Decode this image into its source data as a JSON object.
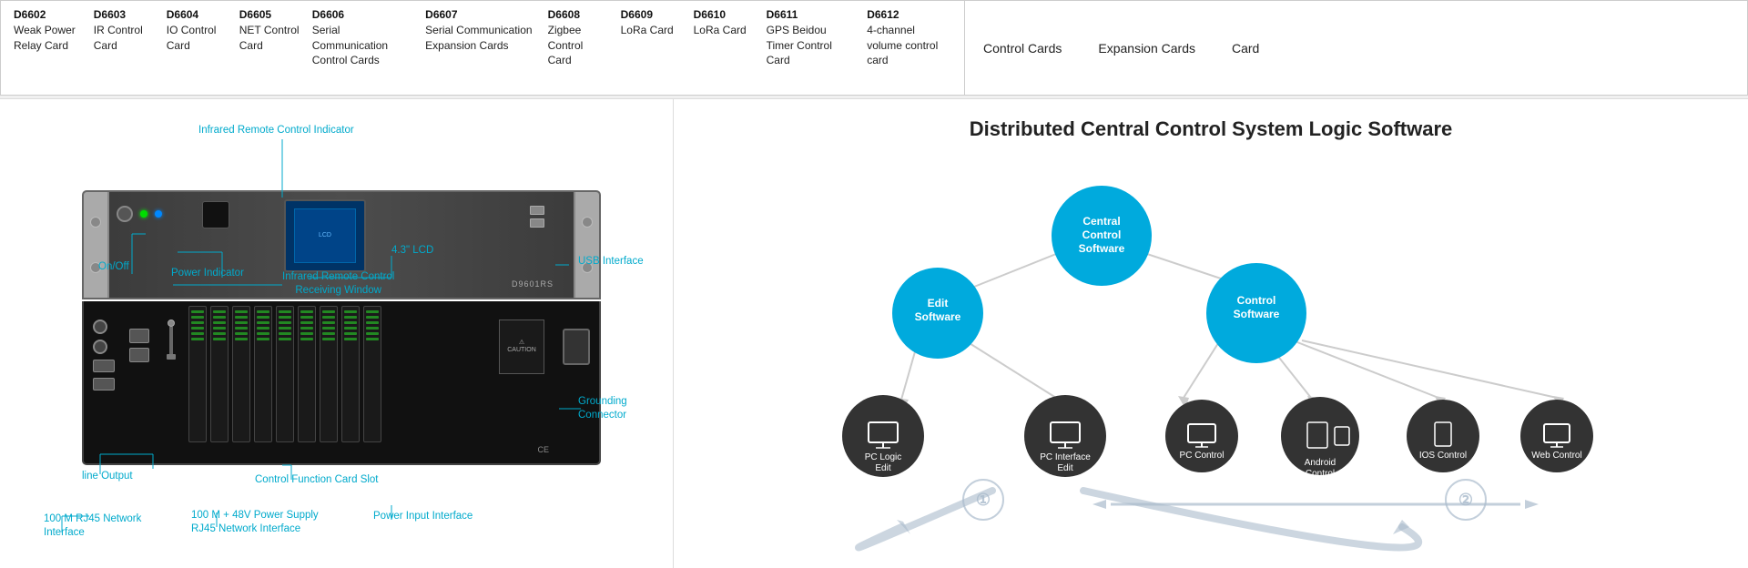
{
  "top_table": {
    "cards": [
      {
        "id": "D6602",
        "name": "Weak Power Relay Card"
      },
      {
        "id": "D6603",
        "name": "IR Control Card"
      },
      {
        "id": "D6604",
        "name": "IO Control Card"
      },
      {
        "id": "D6605",
        "name": "NET Control Card"
      },
      {
        "id": "D6606",
        "name": "Serial Communication Control Cards"
      },
      {
        "id": "D6607",
        "name": "Serial Communication Expansion Cards"
      },
      {
        "id": "D6608",
        "name": "Zigbee Control Card"
      },
      {
        "id": "D6609",
        "name": "LoRa Card"
      },
      {
        "id": "D6610",
        "name": "LoRa Card"
      },
      {
        "id": "D6611",
        "name": "GPS Beidou Timer Control Card"
      },
      {
        "id": "D6612",
        "name": "4-channel volume control card"
      }
    ]
  },
  "top_extra": {
    "control_cards_label": "Control Cards",
    "expansion_cards_label": "Expansion Cards",
    "card_label": "Card"
  },
  "hardware_labels": {
    "on_off": "On/Off",
    "power_indicator": "Power Indicator",
    "ir_indicator": "Infrared Remote Control Indicator",
    "ir_window": "Infrared Remote Control\nReceiving Window",
    "lcd_43": "4.3\" LCD",
    "usb_interface": "USB Interface",
    "grounding_connector": "Grounding\nConnector",
    "line_output": "line Output",
    "control_card_slot": "Control Function Card Slot",
    "network_100m": "100 M RJ45 Network\nInterface",
    "power_supply_100m": "100 M + 48V Power Supply\nRJ45 Network Interface",
    "power_input": "Power Input Interface"
  },
  "logic_diagram": {
    "title": "Distributed Central Control System Logic Software",
    "nodes": [
      {
        "id": "central-control",
        "label": "Central\nControl\nSoftware",
        "type": "blue-large"
      },
      {
        "id": "edit-software",
        "label": "Edit Software",
        "type": "blue-large"
      },
      {
        "id": "control-software",
        "label": "Control\nSoftware",
        "type": "blue-large"
      },
      {
        "id": "pc-logic-edit",
        "label": "PC Logic\nEdit",
        "type": "dark"
      },
      {
        "id": "pc-interface-edit",
        "label": "PC Interface\nEdit",
        "type": "dark"
      },
      {
        "id": "pc-control",
        "label": "PC Control",
        "type": "dark"
      },
      {
        "id": "android-control",
        "label": "Android\nControl",
        "type": "dark"
      },
      {
        "id": "ios-control",
        "label": "IOS Control",
        "type": "dark"
      },
      {
        "id": "web-control",
        "label": "Web Control",
        "type": "dark"
      }
    ],
    "arrows": [
      {
        "label": "①"
      },
      {
        "label": "②"
      }
    ]
  }
}
